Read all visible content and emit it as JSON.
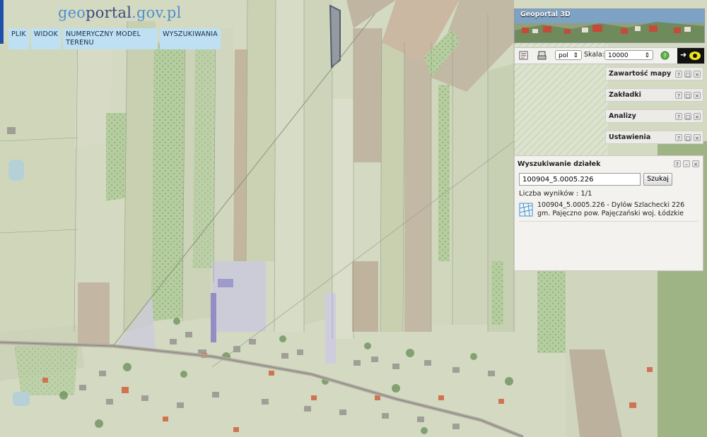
{
  "header": {
    "logo_prefix": "geo",
    "logo_middle": "portal",
    "logo_suffix": ".gov.pl",
    "menu": [
      "PLIK",
      "WIDOK",
      "NUMERYCZNY MODEL TERENU",
      "WYSZUKIWANIA"
    ]
  },
  "geoportal3d": {
    "title": "Geoportal 3D"
  },
  "toolbar": {
    "print_icon": "print-icon",
    "export_icon": "dxf-export-icon",
    "language_value": "pol",
    "scale_label": "Skala:",
    "scale_value": "10000",
    "help_icon": "help-icon",
    "arrow_icon": "arrow-right-icon",
    "eye_icon": "eye-icon"
  },
  "side_panels": [
    {
      "label": "Zawartość mapy"
    },
    {
      "label": "Zakładki"
    },
    {
      "label": "Analizy"
    },
    {
      "label": "Ustawienia"
    }
  ],
  "panel_controls": {
    "help": "?",
    "maximize": "□",
    "close": "×",
    "minimize": "–"
  },
  "search_panel": {
    "title": "Wyszukiwanie działek",
    "input_value": "100904_5.0005.226",
    "button_label": "Szukaj",
    "result_count": "Liczba wyników : 1/1",
    "result": {
      "line1": "100904_5.0005.226 - Dylów Szlachecki 226",
      "line2": "gm. Pajęczno pow. Pajęczański woj. Łódzkie"
    }
  },
  "colors": {
    "menu_bg": "#bfe0f2",
    "accent": "#1f4fa8",
    "map_overlay": "#d9dcc8",
    "parcel_highlight": "#2a3850"
  }
}
